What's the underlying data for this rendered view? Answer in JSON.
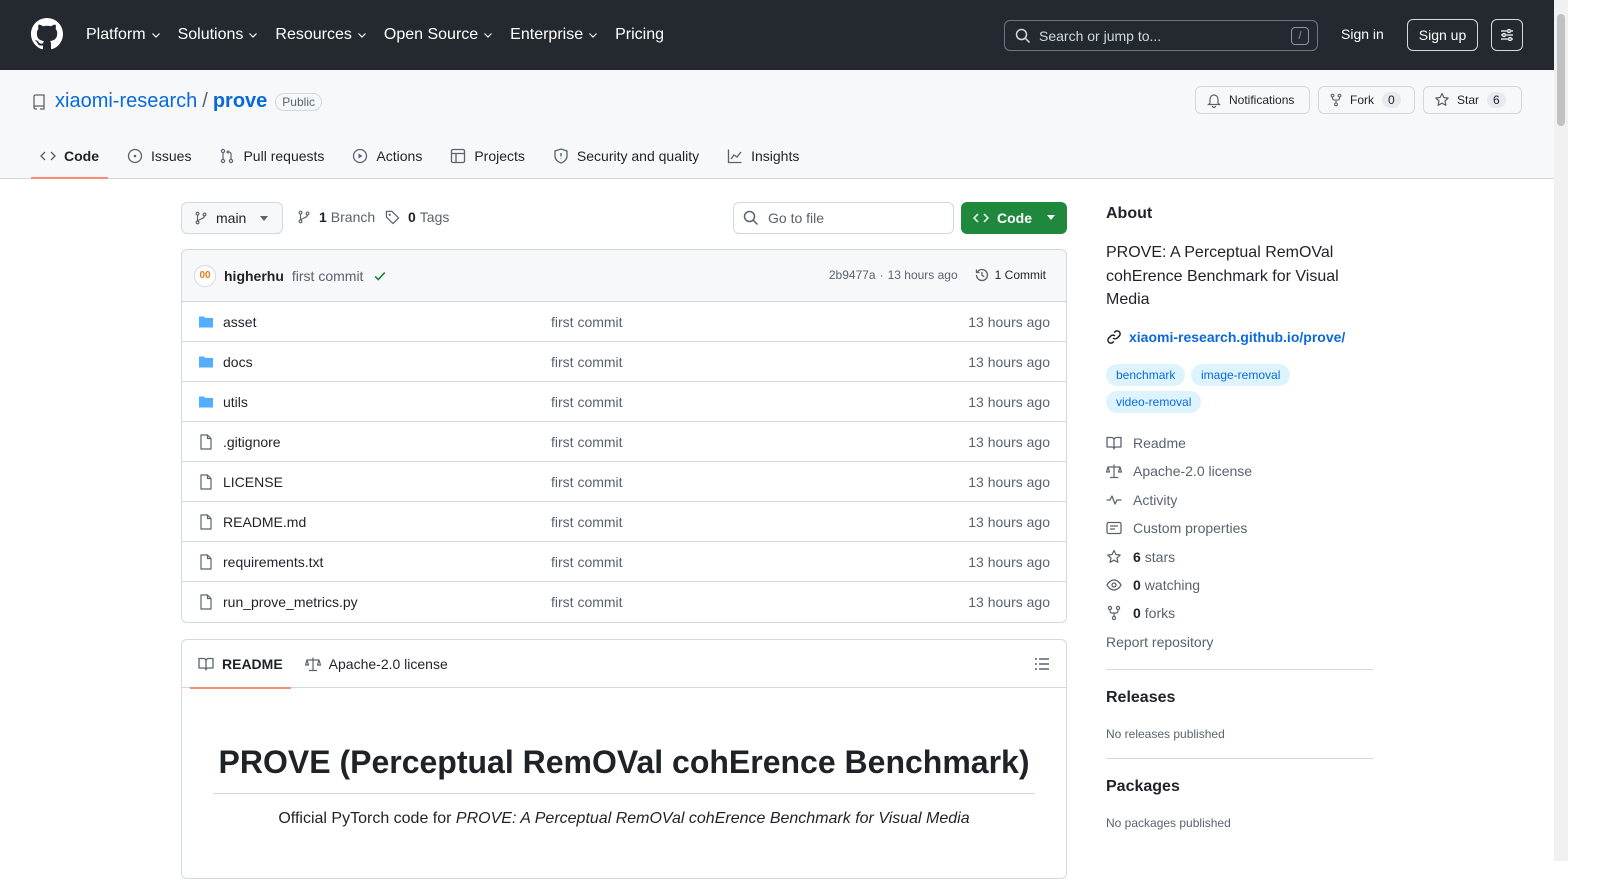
{
  "header": {
    "nav": [
      "Platform",
      "Solutions",
      "Resources",
      "Open Source",
      "Enterprise",
      "Pricing"
    ],
    "search_placeholder": "Search or jump to...",
    "search_shortcut": "/",
    "sign_in": "Sign in",
    "sign_up": "Sign up"
  },
  "repo": {
    "owner": "xiaomi-research",
    "separator": "/",
    "name": "prove",
    "visibility": "Public",
    "notifications_label": "Notifications",
    "fork_label": "Fork",
    "fork_count": "0",
    "star_label": "Star",
    "star_count": "6",
    "tabs": [
      {
        "label": "Code",
        "icon": "code-icon",
        "selected": true
      },
      {
        "label": "Issues",
        "icon": "issue-icon"
      },
      {
        "label": "Pull requests",
        "icon": "pull-request-icon"
      },
      {
        "label": "Actions",
        "icon": "play-icon"
      },
      {
        "label": "Projects",
        "icon": "table-icon"
      },
      {
        "label": "Security and quality",
        "icon": "shield-icon"
      },
      {
        "label": "Insights",
        "icon": "graph-icon"
      }
    ]
  },
  "toolbar": {
    "branch": "main",
    "branches_count": "1",
    "branches_label": "Branch",
    "tags_count": "0",
    "tags_label": "Tags",
    "goto_placeholder": "Go to file",
    "code_label": "Code"
  },
  "commit": {
    "avatar_text": "00",
    "author": "higherhu",
    "message": "first commit",
    "sha": "2b9477a",
    "dot": "·",
    "time": "13 hours ago",
    "history": "1 Commit"
  },
  "files": [
    {
      "name": "asset",
      "type": "dir",
      "message": "first commit",
      "time": "13 hours ago"
    },
    {
      "name": "docs",
      "type": "dir",
      "message": "first commit",
      "time": "13 hours ago"
    },
    {
      "name": "utils",
      "type": "dir",
      "message": "first commit",
      "time": "13 hours ago"
    },
    {
      "name": ".gitignore",
      "type": "file",
      "message": "first commit",
      "time": "13 hours ago"
    },
    {
      "name": "LICENSE",
      "type": "file",
      "message": "first commit",
      "time": "13 hours ago"
    },
    {
      "name": "README.md",
      "type": "file",
      "message": "first commit",
      "time": "13 hours ago"
    },
    {
      "name": "requirements.txt",
      "type": "file",
      "message": "first commit",
      "time": "13 hours ago"
    },
    {
      "name": "run_prove_metrics.py",
      "type": "file",
      "message": "first commit",
      "time": "13 hours ago"
    }
  ],
  "readme": {
    "tab_readme": "README",
    "tab_license": "Apache-2.0 license",
    "title": "PROVE (Perceptual RemOVal cohErence Benchmark)",
    "intro_prefix": "Official PyTorch code for ",
    "intro_italic": "PROVE: A Perceptual RemOVal cohErence Benchmark for Visual Media"
  },
  "sidebar": {
    "about_title": "About",
    "description": "PROVE: A Perceptual RemOVal cohErence Benchmark for Visual Media",
    "website": "xiaomi-research.github.io/prove/",
    "topics": [
      "benchmark",
      "image-removal",
      "video-removal"
    ],
    "readme": "Readme",
    "license": "Apache-2.0 license",
    "activity": "Activity",
    "custom_properties": "Custom properties",
    "stars_count": "6",
    "stars_label": "stars",
    "watching_count": "0",
    "watching_label": "watching",
    "forks_count": "0",
    "forks_label": "forks",
    "report": "Report repository",
    "releases_title": "Releases",
    "releases_text": "No releases published",
    "packages_title": "Packages",
    "packages_text": "No packages published"
  },
  "colors": {
    "header_bg": "#24292f",
    "link": "#0969da",
    "code_button": "#1f883d",
    "tab_underline": "#fd8c73",
    "folder": "#54aeff"
  }
}
